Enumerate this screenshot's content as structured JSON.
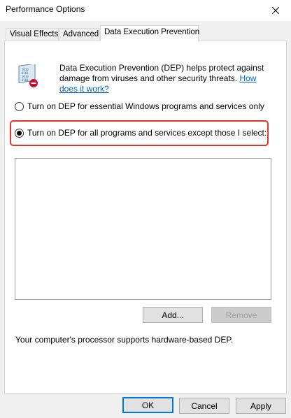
{
  "window": {
    "title": "Performance Options"
  },
  "tabs": [
    {
      "label": "Visual Effects",
      "active": false
    },
    {
      "label": "Advanced",
      "active": false
    },
    {
      "label": "Data Execution Prevention",
      "active": true
    }
  ],
  "dep": {
    "description": "Data Execution Prevention (DEP) helps protect against damage from viruses and other security threats. ",
    "link_label": "How does it work?",
    "icon": "dep-shield-icon",
    "options": [
      {
        "label": "Turn on DEP for essential Windows programs and services only",
        "selected": false
      },
      {
        "label": "Turn on DEP for all programs and services except those I select:",
        "selected": true
      }
    ],
    "exceptions_list": [],
    "add_label": "Add...",
    "remove_label": "Remove",
    "hardware_note": "Your computer's processor supports hardware-based DEP."
  },
  "footer": {
    "ok_label": "OK",
    "cancel_label": "Cancel",
    "apply_label": "Apply"
  },
  "colors": {
    "highlight": "#e0372d",
    "link": "#0066cc",
    "default_button_border": "#0078d7"
  }
}
